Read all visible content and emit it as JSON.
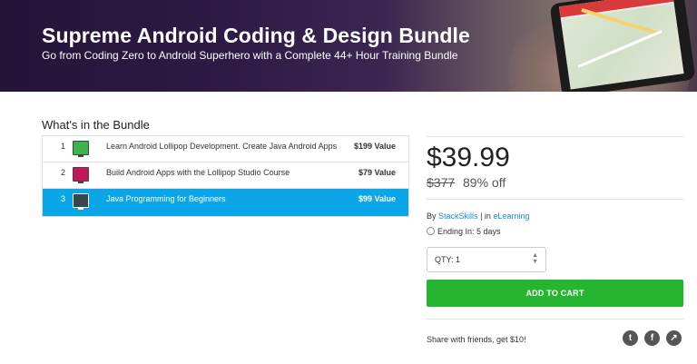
{
  "hero": {
    "title": "Supreme Android Coding & Design Bundle",
    "subtitle": "Go from Coding Zero to Android Superhero with a Complete 44+ Hour Training Bundle"
  },
  "bundle": {
    "heading": "What's in the Bundle",
    "items": [
      {
        "num": "1",
        "title": "Learn Android Lollipop Development. Create Java Android Apps",
        "value": "$199 Value",
        "thumb_color": "#3cb44b"
      },
      {
        "num": "2",
        "title": "Build Android Apps with the Lollipop Studio Course",
        "value": "$79 Value",
        "thumb_color": "#c2185b"
      },
      {
        "num": "3",
        "title": "Java Programming for Beginners",
        "value": "$99 Value",
        "thumb_color": "#37474f"
      }
    ]
  },
  "purchase": {
    "price": "$39.99",
    "original_price": "$377",
    "discount": "89% off",
    "by_prefix": "By",
    "vendor": "StackSkills",
    "in_sep": "| in",
    "category": "eLearning",
    "ending": "Ending In: 5 days",
    "qty_label": "QTY: 1",
    "add_to_cart": "ADD TO CART",
    "share_text": "Share with friends, get $10!"
  },
  "colors": {
    "accent": "#0aa6e8",
    "cart_button": "#26b531",
    "link": "#1a8fd1"
  },
  "icons": [
    "twitter-icon",
    "facebook-icon",
    "share-icon",
    "clock-icon"
  ]
}
